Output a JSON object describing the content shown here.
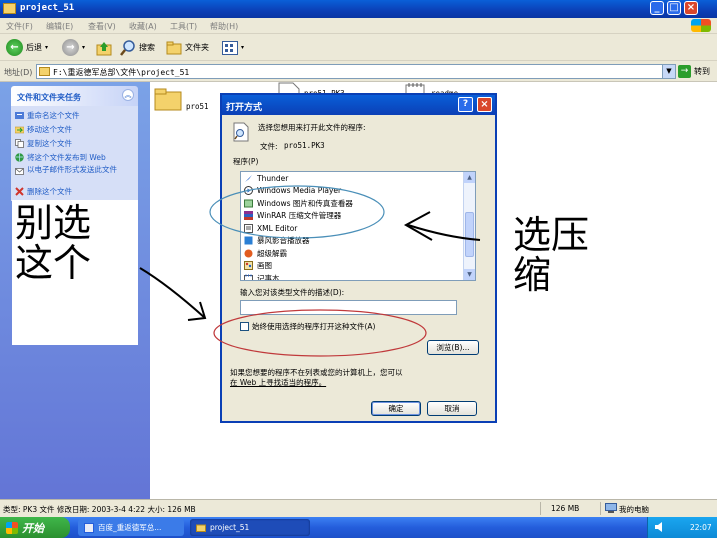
{
  "window": {
    "title": "project_51",
    "buttons": [
      "_",
      "□",
      "×"
    ]
  },
  "menu": [
    "文件(F)",
    "编辑(E)",
    "查看(V)",
    "收藏(A)",
    "工具(T)",
    "帮助(H)"
  ],
  "toolbar": {
    "back": "后退",
    "search": "搜索",
    "folders": "文件夹"
  },
  "address": {
    "label": "地址(D)",
    "value": "F:\\重返德军总部\\文件\\project_51",
    "go": "转到"
  },
  "sidebar": {
    "panel_title": "文件和文件夹任务",
    "tasks": [
      "重命名这个文件",
      "移动这个文件",
      "复制这个文件",
      "将这个文件发布到 Web",
      "以电子邮件形式发送此文件",
      "删除这个文件"
    ]
  },
  "annotations": {
    "left": [
      "别选",
      "这个"
    ],
    "right": [
      "选压",
      "缩"
    ]
  },
  "files": [
    {
      "name": "pro51"
    },
    {
      "name": "pro51.PK3"
    },
    {
      "name": "readme"
    }
  ],
  "dialog": {
    "title": "打开方式",
    "prompt": "选择您想用来打开此文件的程序:",
    "file_label": "文件:",
    "file_name": "pro51.PK3",
    "programs_label": "程序(P)",
    "programs": [
      "Thunder",
      "Windows Media Player",
      "Windows 图片和传真查看器",
      "WinRAR 压缩文件管理器",
      "XML Editor",
      "暴风影音播放器",
      "超级解霸",
      "画图",
      "记事本"
    ],
    "desc_label": "输入您对该类型文件的描述(D):",
    "desc_value": "",
    "always_label": "始终使用选择的程序打开这种文件(A)",
    "browse": "浏览(B)...",
    "footer_line1": "如果您想要的程序不在列表或您的计算机上，您可以",
    "footer_line2": "在 Web 上寻找适当的程序。",
    "ok": "确定",
    "cancel": "取消"
  },
  "status": {
    "info": "类型: PK3 文件 修改日期: 2003-3-4 4:22 大小: 126 MB",
    "size": "126 MB",
    "location": "我的电脑"
  },
  "taskbar": {
    "start": "开始",
    "tasks": [
      "百度_重返德军总...",
      "project_51"
    ],
    "clock": "22:07"
  },
  "colors": {
    "xp_blue": "#0b3fb6",
    "sidebar_blue": "#6375d6",
    "annotation_ellipse_blue": "#4a8fb8",
    "annotation_ellipse_red": "#c0393b"
  }
}
